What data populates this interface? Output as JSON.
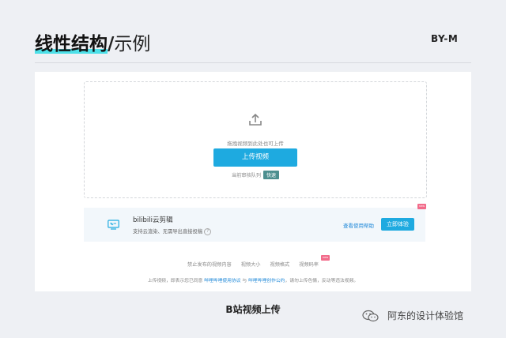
{
  "header": {
    "title_bold": "线性结构",
    "title_slash": "/",
    "title_thin": "示例",
    "brand": "BY-M"
  },
  "colors": {
    "accent_blue": "#1eaae0",
    "highlight": "#4de0e8",
    "badge_teal": "#4d8f8f",
    "new_badge": "#f26b8a",
    "link_blue": "#1e88d8"
  },
  "upload": {
    "icon": "upload-icon",
    "hint": "拖拽视频到此处也可上传",
    "button_label": "上传视频",
    "queue_label": "当前审核队列",
    "queue_status": "快速"
  },
  "banner": {
    "icon": "tv-icon",
    "title": "bilibili云剪辑",
    "subtitle": "支持云渲染、无需导出直接投稿",
    "help_symbol": "?",
    "help_link": "查看使用帮助",
    "try_button": "立即体验",
    "new_badge": "new"
  },
  "footer": {
    "links": [
      "禁止发布的视频内容",
      "视频大小",
      "视频格式",
      "视频码率"
    ],
    "new_badge": "new",
    "note_prefix": "上传视频，即表示您已同意",
    "note_link1": "哔哩哔哩使用协议",
    "note_mid": "与",
    "note_link2": "哔哩哔哩创作公约",
    "note_suffix": "，请勿上传色情，反动等违法视频。"
  },
  "caption": "B站视频上传",
  "watermark": {
    "icon": "wechat-icon",
    "text": "阿东的设计体验馆"
  }
}
